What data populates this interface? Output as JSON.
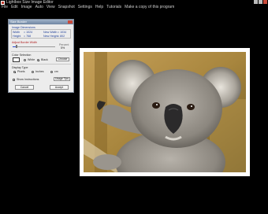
{
  "window": {
    "title": "Lightbox Size Image Editor"
  },
  "menu": [
    "File",
    "Edit",
    "Image",
    "Auto",
    "View",
    "Snapshot",
    "Settings",
    "Help",
    "Tutorials",
    "Make a copy of this program"
  ],
  "dialog": {
    "title": "Size Border",
    "dimensions_label": "Image Dimensions",
    "width_label": "Width",
    "width_value": "= 1024",
    "height_label": "Height",
    "height_value": "= 768",
    "new_width_label": "New Width",
    "new_width_value": "= 1034",
    "new_height_label": "New Height",
    "new_height_value": "= 802",
    "adjust_label": "Adjust Border Width",
    "percent_label": "Percent",
    "percent_value": "5%",
    "color_label": "Color Selection",
    "color_options": [
      "White",
      "Black"
    ],
    "color_selected": "Black",
    "choose_label": "Choose",
    "display_type_label": "Display Type",
    "display_options": [
      "Pixels",
      "Inches",
      "cm"
    ],
    "display_selected": "Pixels",
    "show_instructions_label": "Show Instructions",
    "usage_tips_label": "Usage Tips",
    "cancel_label": "Cancel",
    "accept_label": "Accept",
    "border_fraction": 0.05,
    "accent_color": "#1f3f99"
  },
  "canvas": {
    "background": "#000000",
    "border_color": "#ffffff"
  }
}
